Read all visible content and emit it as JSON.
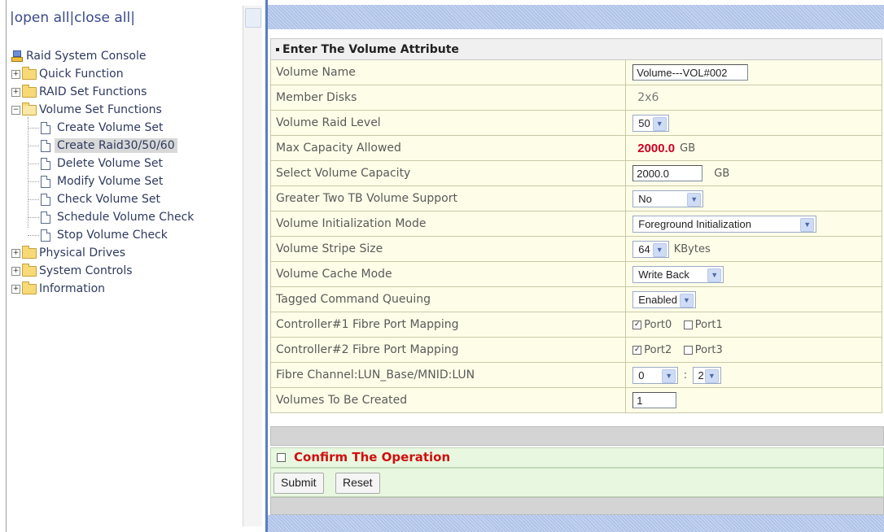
{
  "nav": {
    "open_all": "open all",
    "close_all": "close all",
    "root": "Raid System Console",
    "groups": [
      {
        "label": "Quick Function"
      },
      {
        "label": "RAID Set Functions"
      },
      {
        "label": "Volume Set Functions",
        "items": [
          "Create Volume Set",
          "Create Raid30/50/60",
          "Delete Volume Set",
          "Modify Volume Set",
          "Check Volume Set",
          "Schedule Volume Check",
          "Stop Volume Check"
        ]
      },
      {
        "label": "Physical Drives"
      },
      {
        "label": "System Controls"
      },
      {
        "label": "Information"
      }
    ],
    "selected_item": "Create Raid30/50/60"
  },
  "form": {
    "title": "Enter The Volume Attribute",
    "rows": {
      "volume_name": {
        "label": "Volume Name",
        "value": "Volume---VOL#002"
      },
      "member_disks": {
        "label": "Member Disks",
        "value": "2x6"
      },
      "raid_level": {
        "label": "Volume Raid Level",
        "value": "50"
      },
      "max_capacity": {
        "label": "Max Capacity Allowed",
        "value": "2000.0",
        "unit": "GB"
      },
      "select_capacity": {
        "label": "Select Volume Capacity",
        "value": "2000.0",
        "unit": "GB"
      },
      "greater_two_tb": {
        "label": "Greater Two TB Volume Support",
        "value": "No"
      },
      "init_mode": {
        "label": "Volume Initialization Mode",
        "value": "Foreground Initialization"
      },
      "stripe_size": {
        "label": "Volume Stripe Size",
        "value": "64",
        "unit": "KBytes"
      },
      "cache_mode": {
        "label": "Volume Cache Mode",
        "value": "Write Back"
      },
      "tcq": {
        "label": "Tagged Command Queuing",
        "value": "Enabled"
      },
      "ctrl1_mapping": {
        "label": "Controller#1 Fibre Port Mapping",
        "port_a": "Port0",
        "port_a_checked": true,
        "port_b": "Port1",
        "port_b_checked": false
      },
      "ctrl2_mapping": {
        "label": "Controller#2 Fibre Port Mapping",
        "port_a": "Port2",
        "port_a_checked": true,
        "port_b": "Port3",
        "port_b_checked": false
      },
      "lun": {
        "label": "Fibre Channel:LUN_Base/MNID:LUN",
        "base": "0",
        "separator": ":",
        "lun": "2"
      },
      "volumes_count": {
        "label": "Volumes To Be Created",
        "value": "1"
      }
    },
    "confirm_label": "Confirm The Operation",
    "submit_label": "Submit",
    "reset_label": "Reset"
  },
  "colors": {
    "accent_red": "#cc0022",
    "divider_blue": "#5a7ec0"
  }
}
